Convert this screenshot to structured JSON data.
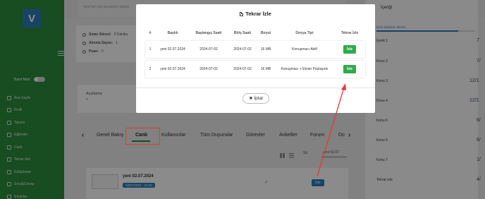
{
  "sidebar": {
    "logo": "V",
    "basit_mod": "Basit Mod",
    "items": [
      {
        "label": "Ana Sayfa",
        "icon": "home-icon"
      },
      {
        "label": "Profil",
        "icon": "user-icon"
      },
      {
        "label": "Takvim",
        "icon": "calendar-icon"
      },
      {
        "label": "Eğitimler",
        "icon": "book-icon"
      },
      {
        "label": "Canlı",
        "icon": "live-icon"
      },
      {
        "label": "Tekrar İzle",
        "icon": "replay-icon"
      },
      {
        "label": "Kütüphane",
        "icon": "library-icon"
      },
      {
        "label": "Soru&Cevap",
        "icon": "qa-icon"
      },
      {
        "label": "Sınavlar",
        "icon": "exam-icon"
      }
    ]
  },
  "background": {
    "top_title": "TESTİN ADI EKLENTİ ŞİMDİ",
    "info": [
      {
        "label": "Sınav Süresi:",
        "value": "0 Dakika"
      },
      {
        "label": "Alınma Sayısı:",
        "value": "1"
      },
      {
        "label": "Puan:",
        "value": "0"
      }
    ],
    "description_label": "Açıklama",
    "description_value": "s",
    "tabs": [
      "Genel Bakış",
      "Canlı",
      "Kullanıcılar",
      "Tüm Duyurular",
      "Görevler",
      "Anketler",
      "Forum",
      "Do"
    ],
    "sort_label": "Sıl",
    "search_value": "yeni 02.07",
    "list_item": {
      "title": "yeni 02.07.2024",
      "date_badge": "02/07/2024 - 16:36",
      "button": "İzle"
    },
    "right": {
      "header": "İçeriği",
      "progress_label": "Kurs ilerleme: 83.0%",
      "progress": 0.83,
      "items": [
        {
          "label": "İçerik 1",
          "num": "7"
        },
        {
          "label": "Konu 2",
          "num": "7/"
        },
        {
          "label": "Konu 3",
          "num": "12/1"
        },
        {
          "label": "Konu 4",
          "num": "12/1"
        },
        {
          "label": "Konu 6",
          "num": "6/"
        },
        {
          "label": "Konu 5",
          "num": "6/"
        },
        {
          "label": "Konu 7",
          "num": "1/"
        },
        {
          "label": "Tekrar izle",
          "num": "4/"
        }
      ]
    }
  },
  "modal": {
    "title": "Tekrar İzle",
    "columns": [
      "#",
      "Başlık",
      "Başlangıç Saati",
      "Bitiş Saati",
      "Boyut",
      "Dosya Tipi",
      "Tekrar İzle"
    ],
    "rows": [
      {
        "no": "1",
        "title": "yeni 02.07.2024",
        "start": "2024-07-02",
        "end": "2024-07-02",
        "size": "16 MB",
        "type": "Konuşmacı Aktif",
        "action": "İzle"
      },
      {
        "no": "2",
        "title": "yeni 02.07.2024",
        "start": "2024-07-02",
        "end": "2024-07-02",
        "size": "16 MB",
        "type": "Konuşmacı + Ekran Paylaşımı",
        "action": "İzle"
      }
    ],
    "cancel": "İptal"
  },
  "colors": {
    "sidebar": "#2d8a3c",
    "accent_blue": "#2a7db8",
    "button_green": "#2eaa4b",
    "highlight_red": "#e53935"
  }
}
